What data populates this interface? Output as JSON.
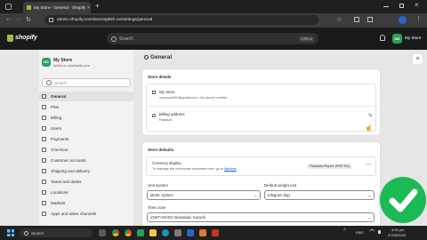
{
  "browser": {
    "tab_title": "My Store - General · Shopify",
    "new_tab": "+",
    "url": "admin.shopify.com/store/splish-ov/settings/general"
  },
  "topbar": {
    "logo": "shopify",
    "search_placeholder": "Search",
    "shortcut": "CTRL K",
    "store_initials": "MS",
    "store_name": "My Store"
  },
  "sidebar": {
    "store_initials": "MS",
    "store_name": "My Store",
    "store_domain": "splish-ov.myshopify.com",
    "search_placeholder": "Search",
    "items": [
      {
        "label": "General"
      },
      {
        "label": "Plan"
      },
      {
        "label": "Billing"
      },
      {
        "label": "Users"
      },
      {
        "label": "Payments"
      },
      {
        "label": "Checkout"
      },
      {
        "label": "Customer accounts"
      },
      {
        "label": "Shipping and delivery"
      },
      {
        "label": "Taxes and duties"
      },
      {
        "label": "Locations"
      },
      {
        "label": "Markets"
      },
      {
        "label": "Apps and sales channels"
      }
    ]
  },
  "page": {
    "title": "General",
    "store_details": {
      "heading": "Store details",
      "store_name": "My Store",
      "store_contact": "storyworld02@gmail.com • No phone number",
      "billing_label": "Billing address",
      "billing_value": "Pakistan"
    },
    "store_defaults": {
      "heading": "Store defaults",
      "currency_label": "Currency display",
      "currency_desc": "To manage the currencies customers see, go to",
      "currency_link": "Markets",
      "currency_value": "Pakistani Rupee (PKR Rs)",
      "unit_label": "Unit system",
      "unit_value": "Metric system",
      "weight_label": "Default weight unit",
      "weight_value": "Kilogram (kg)",
      "timezone_label": "Time zone",
      "timezone_value": "(GMT+05:00) Islamabad, Karachi"
    }
  },
  "taskbar": {
    "search": "Search",
    "lang": "ENG",
    "time": "4:04 pm",
    "date": "27/05/2023"
  },
  "colors": {
    "accent_green": "#1db954",
    "shopify_green": "#95bf47",
    "avatar_green": "#2e9e5b"
  }
}
